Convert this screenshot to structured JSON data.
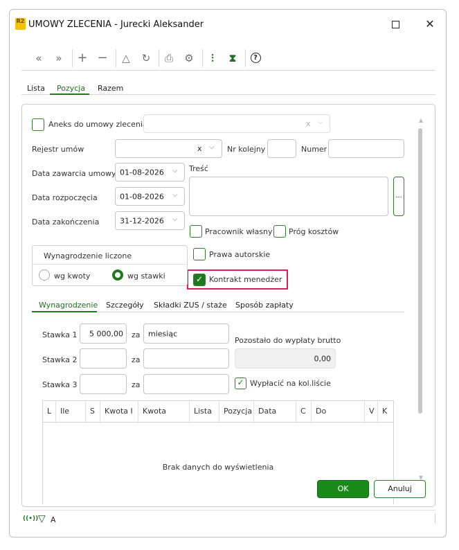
{
  "window": {
    "title": "UMOWY ZLECENIA - Jurecki Aleksander",
    "logo_text": "R2"
  },
  "toolbar": {
    "first": "«",
    "prev": "»",
    "add": "+",
    "remove": "−",
    "triangle": "△",
    "refresh": "↻",
    "print": "⎙",
    "settings": "⚙",
    "columns": "⫶",
    "hourglass": "⧗",
    "help": "?"
  },
  "top_tabs": [
    {
      "label": "Lista"
    },
    {
      "label": "Pozycja"
    },
    {
      "label": "Razem"
    }
  ],
  "form": {
    "aneks_label": "Aneks do umowy zlecenia",
    "aneks_clear": "x",
    "rejestr_label": "Rejestr umów",
    "rejestr_clear": "x",
    "nr_kolejny_label": "Nr kolejny",
    "numer_label": "Numer",
    "data_zawarcia_label": "Data zawarcia umowy",
    "data_zawarcia_value": "01-08-2026",
    "data_rozpoczecia_label": "Data rozpoczęcia",
    "data_rozpoczecia_value": "01-08-2026",
    "data_zakonczenia_label": "Data zakończenia",
    "data_zakonczenia_value": "31-12-2026",
    "tresc_label": "Treść",
    "tresc_button": "...",
    "pracownik_wlasny_label": "Pracownik własny",
    "prog_kosztow_label": "Próg kosztów",
    "prawa_autorskie_label": "Prawa autorskie",
    "kontrakt_menedzer_label": "Kontrakt menedżer",
    "wynagrodzenie_group_title": "Wynagrodzenie liczone",
    "wg_kwoty_label": "wg kwoty",
    "wg_stawki_label": "wg stawki"
  },
  "sub_tabs": [
    {
      "label": "Wynagrodzenie"
    },
    {
      "label": "Szczegóły"
    },
    {
      "label": "Składki ZUS / staże"
    },
    {
      "label": "Sposób zapłaty"
    }
  ],
  "wynagrodzenie": {
    "stawka1_label": "Stawka 1",
    "stawka1_value": "5 000,00",
    "za1": "za",
    "jednostka1": "miesiąc",
    "stawka2_label": "Stawka 2",
    "za2": "za",
    "stawka3_label": "Stawka 3",
    "za3": "za",
    "pozostalo_label": "Pozostało do wypłaty brutto",
    "pozostalo_value": "0,00",
    "wyplacic_label": "Wypłacić na kol.liście"
  },
  "table": {
    "columns": [
      "L",
      "Ile",
      "S",
      "Kwota I",
      "Kwota",
      "Lista",
      "Pozycja",
      "Data",
      "C",
      "Do",
      "V",
      "K"
    ],
    "empty_text": "Brak danych do wyświetlenia"
  },
  "buttons": {
    "ok": "OK",
    "anuluj": "Anuluj"
  },
  "statusbar": {
    "signal": "((•))",
    "filter": "▽",
    "letter": "A"
  },
  "colors": {
    "accent": "#1f7a1f",
    "highlight": "#e0195a"
  }
}
